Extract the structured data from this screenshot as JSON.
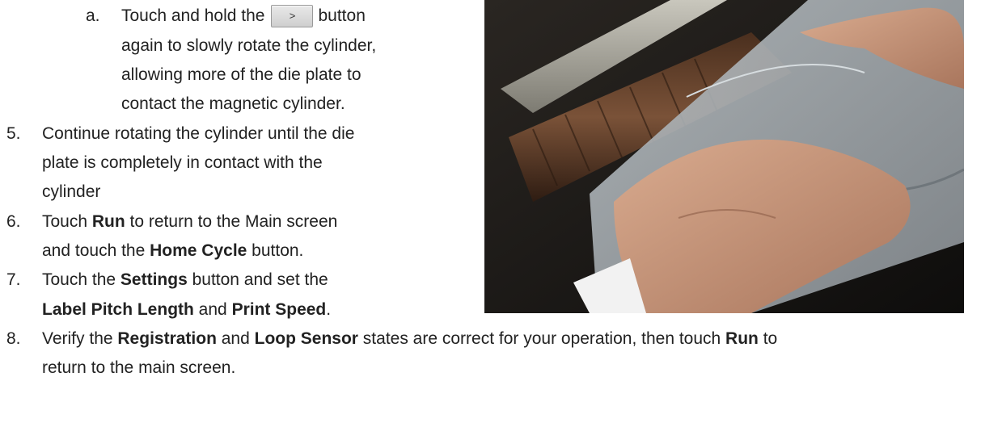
{
  "steps": {
    "sub_a": {
      "marker": "a.",
      "line1_pre": "Touch and hold the",
      "button_label": ">",
      "line1_post": "button",
      "line2": "again to slowly rotate the cylinder,",
      "line3": "allowing more of the die plate to",
      "line4": "contact the magnetic cylinder."
    },
    "step5": {
      "number": "5.",
      "line1": "Continue rotating the cylinder until the die",
      "line2": "plate is completely in contact with the",
      "line3": "cylinder"
    },
    "step6": {
      "number": "6.",
      "t1": "Touch ",
      "b1": "Run",
      "t2": " to return to the Main screen",
      "t3": "and touch the ",
      "b2": "Home Cycle",
      "t4": " button."
    },
    "step7": {
      "number": "7.",
      "t1": "Touch the ",
      "b1": "Settings",
      "t2": " button and set the",
      "b2": "Label Pitch Length",
      "t3": " and ",
      "b3": "Print Speed",
      "t4": "."
    },
    "step8": {
      "number": "8.",
      "t1": "Verify the ",
      "b1": "Registration",
      "t2": " and ",
      "b2": "Loop Sensor",
      "t3": " states are correct for your operation, then touch ",
      "b3": "Run",
      "t4": " to",
      "line2": "return to the main screen."
    }
  }
}
